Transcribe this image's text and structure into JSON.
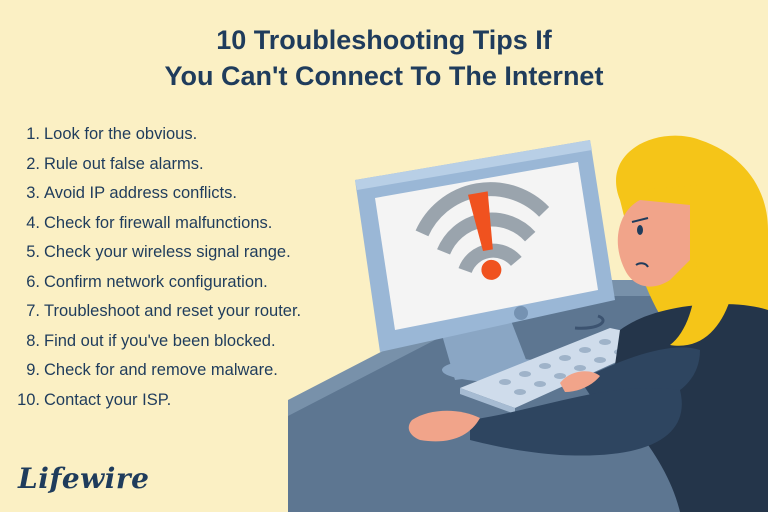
{
  "header": {
    "title_line1": "10 Troubleshooting Tips If",
    "title_line2": "You Can't Connect To The Internet"
  },
  "tips": [
    {
      "num": "1.",
      "text": "Look for the obvious."
    },
    {
      "num": "2.",
      "text": "Rule out false alarms."
    },
    {
      "num": "3.",
      "text": "Avoid IP address conflicts."
    },
    {
      "num": "4.",
      "text": "Check for firewall malfunctions."
    },
    {
      "num": "5.",
      "text": "Check your wireless signal range."
    },
    {
      "num": "6.",
      "text": "Confirm network configuration."
    },
    {
      "num": "7.",
      "text": "Troubleshoot and reset your router."
    },
    {
      "num": "8.",
      "text": "Find out if you've been blocked."
    },
    {
      "num": "9.",
      "text": "Check for and remove malware."
    },
    {
      "num": "10.",
      "text": "Contact your ISP."
    }
  ],
  "brand": {
    "logo_text": "Lifewire"
  },
  "colors": {
    "background": "#fbf0c4",
    "text": "#1f3c5c",
    "accent_orange": "#f0521f",
    "hair_yellow": "#f5c518"
  },
  "illustration": {
    "icons": [
      "computer-monitor-icon",
      "wifi-warning-icon",
      "keyboard-icon",
      "person-icon"
    ]
  }
}
